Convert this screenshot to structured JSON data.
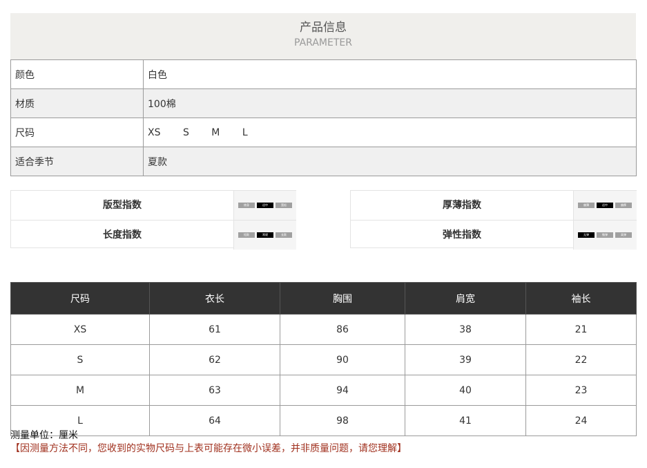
{
  "header": {
    "title_cn": "产品信息",
    "title_en": "PARAMETER"
  },
  "params": [
    {
      "label": "颜色",
      "value": "白色"
    },
    {
      "label": "材质",
      "value": "100棉"
    },
    {
      "label": "尺码",
      "sizes": [
        "XS",
        "S",
        "M",
        "L"
      ]
    },
    {
      "label": "适合季节",
      "value": "夏款"
    }
  ],
  "indices": {
    "fit": {
      "label": "版型指数",
      "options": [
        "修身",
        "适中",
        "宽松"
      ],
      "selected_index": 1
    },
    "length": {
      "label": "长度指数",
      "options": [
        "短款",
        "常规",
        "长款"
      ],
      "selected_index": 1
    },
    "thickness": {
      "label": "厚薄指数",
      "options": [
        "偏薄",
        "适中",
        "偏厚"
      ],
      "selected_index": 1
    },
    "elasticity": {
      "label": "弹性指数",
      "options": [
        "无弹",
        "微弹",
        "高弹"
      ],
      "selected_index": 0
    }
  },
  "size_table": {
    "headers": [
      "尺码",
      "衣长",
      "胸围",
      "肩宽",
      "袖长"
    ],
    "rows": [
      [
        "XS",
        "61",
        "86",
        "38",
        "21"
      ],
      [
        "S",
        "62",
        "90",
        "39",
        "22"
      ],
      [
        "M",
        "63",
        "94",
        "40",
        "23"
      ],
      [
        "L",
        "64",
        "98",
        "41",
        "24"
      ]
    ]
  },
  "notes": {
    "unit": "测量单位：厘米",
    "disclaimer": "【因测量方法不同，您收到的实物尺码与上表可能存在微小误差，并非质量问题，请您理解】"
  },
  "colors": {
    "header_band": "#f0efec",
    "table_header": "#333333",
    "chip_on": "#000000",
    "chip_off": "#a0a0a0",
    "disclaimer": "#a0301e"
  }
}
